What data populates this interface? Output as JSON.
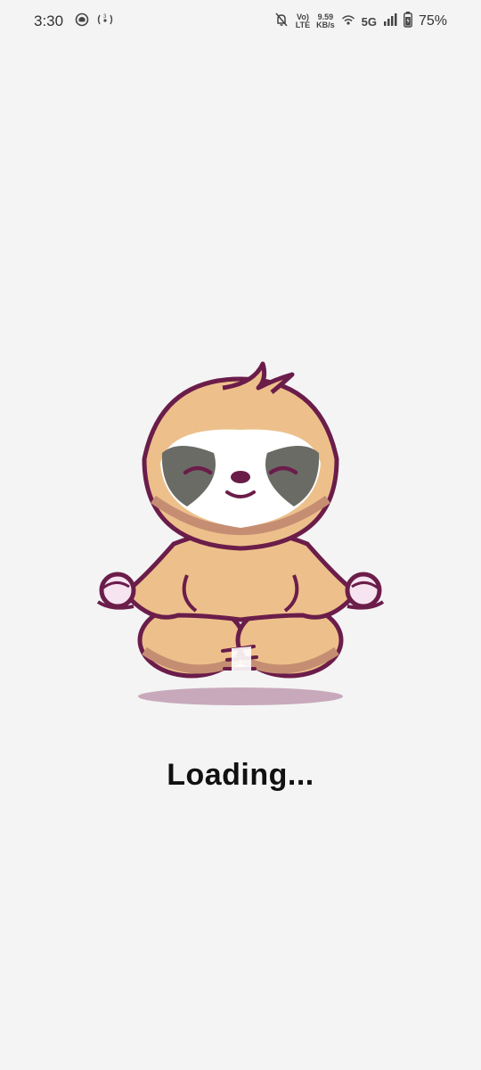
{
  "status_bar": {
    "time": "3:30",
    "network_speed_value": "9.59",
    "network_speed_unit": "KB/s",
    "volte_top": "Vo)",
    "volte_bottom": "LTE",
    "network_type": "5G",
    "battery_percent": "75%",
    "icons": [
      "snapchat-ghost-icon",
      "hotspot-icon",
      "mute-notifications-icon",
      "volte-icon",
      "wifi-icon",
      "signal-icon",
      "battery-icon"
    ]
  },
  "main": {
    "illustration": "meditating-sloth",
    "loading_text": "Loading..."
  },
  "colors": {
    "background": "#f4f4f4",
    "sloth_fur": "#edc08b",
    "sloth_outline": "#6b1d4a",
    "face_mask": "#ffffff",
    "eye_patch": "#6b6b66",
    "shadow": "#c8a9bb"
  }
}
